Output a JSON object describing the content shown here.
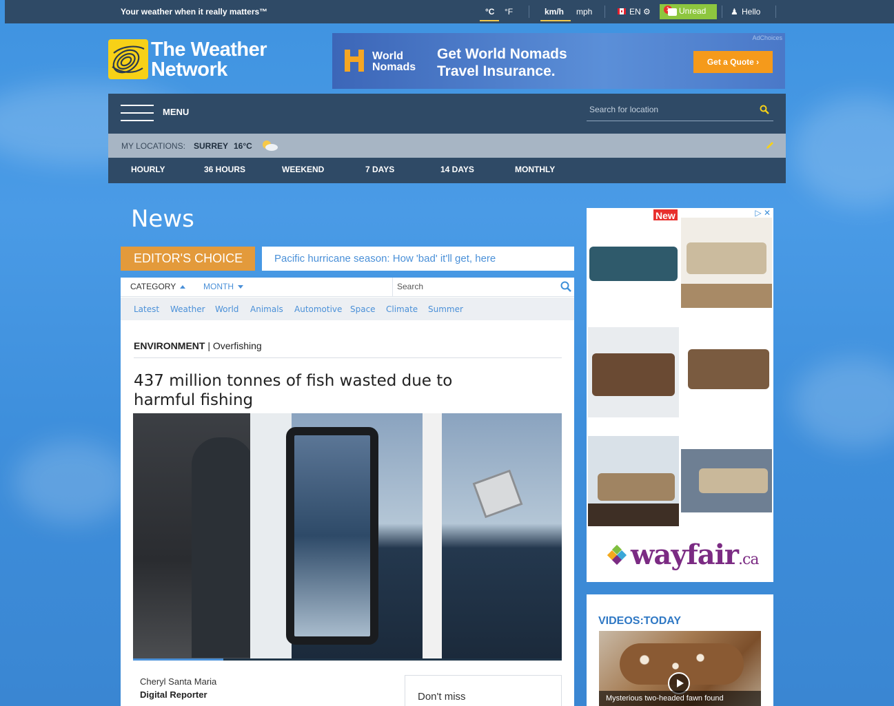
{
  "topbar": {
    "tagline": "Your weather when it really matters™",
    "units": {
      "celsius": "°C",
      "fahrenheit": "°F",
      "kmh": "km/h",
      "mph": "mph"
    },
    "language": "EN",
    "unread": "Unread",
    "unread_count": "1",
    "user": "Hello"
  },
  "logo": {
    "line1": "The Weather",
    "line2": "Network"
  },
  "banner": {
    "adchoices": "AdChoices",
    "brand_line1": "World",
    "brand_line2": "Nomads",
    "headline_line1": "Get World Nomads",
    "headline_line2": "Travel Insurance.",
    "cta": "Get a Quote ›"
  },
  "menu": {
    "label": "MENU",
    "search_placeholder": "Search for location"
  },
  "my_locations": {
    "label": "MY LOCATIONS:",
    "city": "SURREY",
    "temp": "16°C"
  },
  "forecast_tabs": [
    "HOURLY",
    "36 HOURS",
    "WEEKEND",
    "7 DAYS",
    "14 DAYS",
    "MONTHLY"
  ],
  "news": {
    "title": "News",
    "editors_choice": "EDITOR'S CHOICE",
    "editors_link": "Pacific hurricane season: How 'bad' it'll get, here",
    "filter_category": "CATEGORY",
    "filter_month": "MONTH",
    "search_placeholder": "Search",
    "categories": [
      "Latest",
      "Weather",
      "World",
      "Animals",
      "Automotive",
      "Space",
      "Climate",
      "Summer"
    ],
    "section": "ENVIRONMENT",
    "subsection": "| Overfishing",
    "headline": "437 million tonnes of fish wasted due to harmful fishing",
    "video_progress": 0.21,
    "author": "Cheryl Santa Maria",
    "author_role": "Digital Reporter",
    "dont_miss": "Don't miss"
  },
  "sidead": {
    "new_badge": "New",
    "brand": "wayfair",
    "brand_suffix": ".ca"
  },
  "videos": {
    "heading": "VIDEOS:TODAY",
    "caption": "Mysterious two-headed fawn found"
  }
}
